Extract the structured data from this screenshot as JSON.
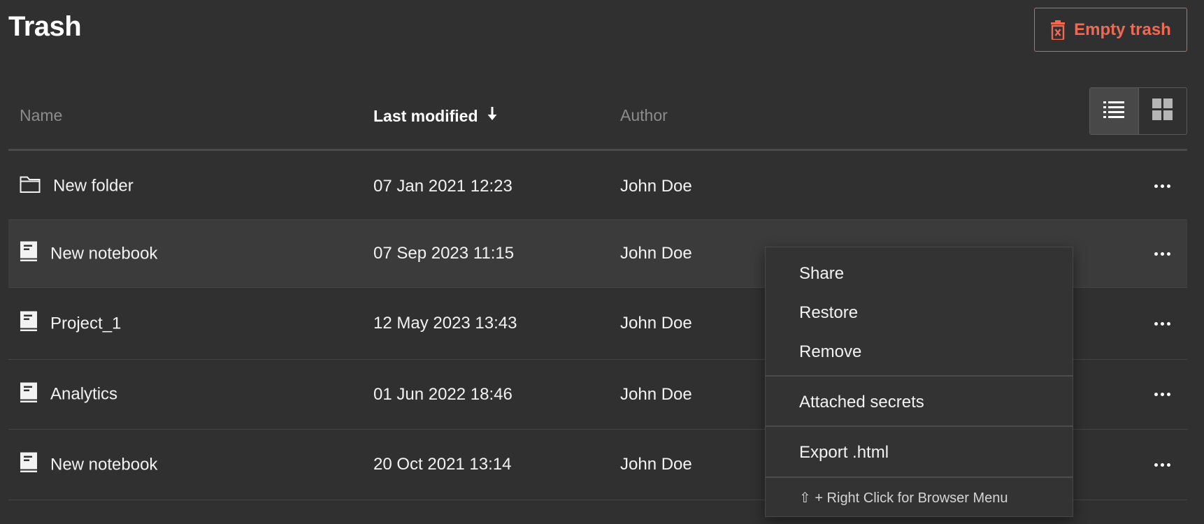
{
  "page": {
    "title": "Trash",
    "empty_trash_label": "Empty trash"
  },
  "table": {
    "columns": {
      "name": "Name",
      "last_modified": "Last modified",
      "author": "Author"
    },
    "sort": {
      "column": "last_modified",
      "direction": "descending"
    },
    "view": "list",
    "rows": [
      {
        "type": "folder",
        "name": "New folder",
        "modified": "07 Jan 2021 12:23",
        "author": "John Doe"
      },
      {
        "type": "notebook",
        "name": "New notebook",
        "modified": "07 Sep 2023 11:15",
        "author": "John Doe"
      },
      {
        "type": "notebook",
        "name": "Project_1",
        "modified": "12 May 2023 13:43",
        "author": "John Doe"
      },
      {
        "type": "notebook",
        "name": "Analytics",
        "modified": "01 Jun 2022 18:46",
        "author": "John Doe"
      },
      {
        "type": "notebook",
        "name": "New notebook",
        "modified": "20 Oct 2021 13:14",
        "author": "John Doe"
      }
    ]
  },
  "context_menu": {
    "items": [
      "Share",
      "Restore",
      "Remove",
      "Attached secrets",
      "Export .html"
    ],
    "hint": "⇧ + Right Click for Browser Menu"
  },
  "colors": {
    "background": "#303030",
    "accent_danger": "#ef6a55",
    "selected_row": "#3b3b3b"
  }
}
